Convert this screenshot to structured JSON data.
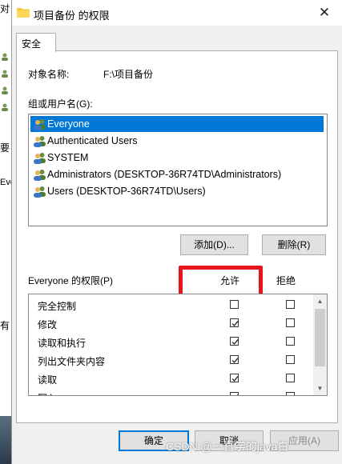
{
  "window": {
    "title": "项目备份 的权限",
    "close_glyph": "✕"
  },
  "background_fragments": [
    "对",
    "要",
    "Eve",
    "有"
  ],
  "tabs": [
    {
      "label": "安全"
    }
  ],
  "object": {
    "label": "对象名称:",
    "value": "F:\\项目备份"
  },
  "groups": {
    "label": "组或用户名(G):",
    "users": [
      {
        "name": "Everyone",
        "selected": true
      },
      {
        "name": "Authenticated Users",
        "selected": false
      },
      {
        "name": "SYSTEM",
        "selected": false
      },
      {
        "name": "Administrators (DESKTOP-36R74TD\\Administrators)",
        "selected": false
      },
      {
        "name": "Users (DESKTOP-36R74TD\\Users)",
        "selected": false
      }
    ]
  },
  "buttons": {
    "add": "添加(D)...",
    "remove": "删除(R)"
  },
  "permissions": {
    "label": "Everyone 的权限(P)",
    "allow_header": "允许",
    "deny_header": "拒绝",
    "rows": [
      {
        "name": "完全控制",
        "allow": false,
        "deny": false
      },
      {
        "name": "修改",
        "allow": true,
        "deny": false
      },
      {
        "name": "读取和执行",
        "allow": true,
        "deny": false
      },
      {
        "name": "列出文件夹内容",
        "allow": true,
        "deny": false
      },
      {
        "name": "读取",
        "allow": true,
        "deny": false
      },
      {
        "name": "写入",
        "allow": true,
        "deny": false
      }
    ]
  },
  "footer": {
    "ok": "确定",
    "cancel": "取消",
    "apply": "应用(A)"
  },
  "watermark": "CSDN @一直学的java白",
  "colors": {
    "selection": "#0078d7",
    "highlight_box": "#e8131b",
    "focus_border": "#0078d7"
  }
}
